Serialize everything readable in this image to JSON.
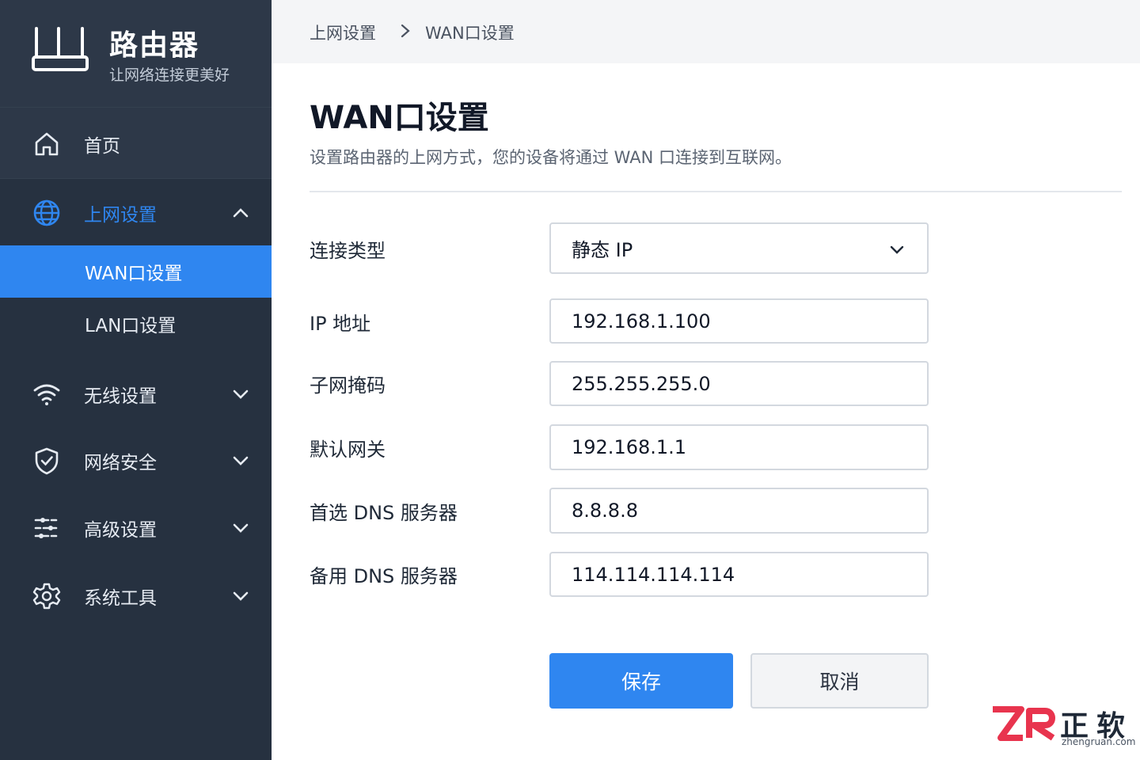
{
  "brand": {
    "title": "路由器",
    "subtitle": "让网络连接更美好"
  },
  "sidebar": {
    "home": "首页",
    "internet": {
      "label": "上网设置",
      "children": [
        "WAN口设置",
        "LAN口设置"
      ]
    },
    "items": [
      "无线设置",
      "网络安全",
      "高级设置",
      "系统工具"
    ]
  },
  "breadcrumb": [
    "上网设置",
    "WAN口设置"
  ],
  "page": {
    "title": "WAN口设置",
    "description": "设置路由器的上网方式，您的设备将通过 WAN 口连接到互联网。"
  },
  "form": {
    "connection_type": {
      "label": "连接类型",
      "value": "静态 IP"
    },
    "ip": {
      "label": "IP 地址",
      "value": "192.168.1.100"
    },
    "mask": {
      "label": "子网掩码",
      "value": "255.255.255.0"
    },
    "gateway": {
      "label": "默认网关",
      "value": "192.168.1.1"
    },
    "dns1": {
      "label": "首选 DNS 服务器",
      "value": "8.8.8.8"
    },
    "dns2": {
      "label": "备用 DNS 服务器",
      "value": "114.114.114.114"
    }
  },
  "buttons": {
    "save": "保存",
    "cancel": "取消"
  },
  "watermark": {
    "cn": "正软",
    "en": "zhengruan.com"
  },
  "colors": {
    "sidebar_bg": "#263140",
    "accent": "#2f86f0",
    "brand_red": "#e8344e"
  }
}
